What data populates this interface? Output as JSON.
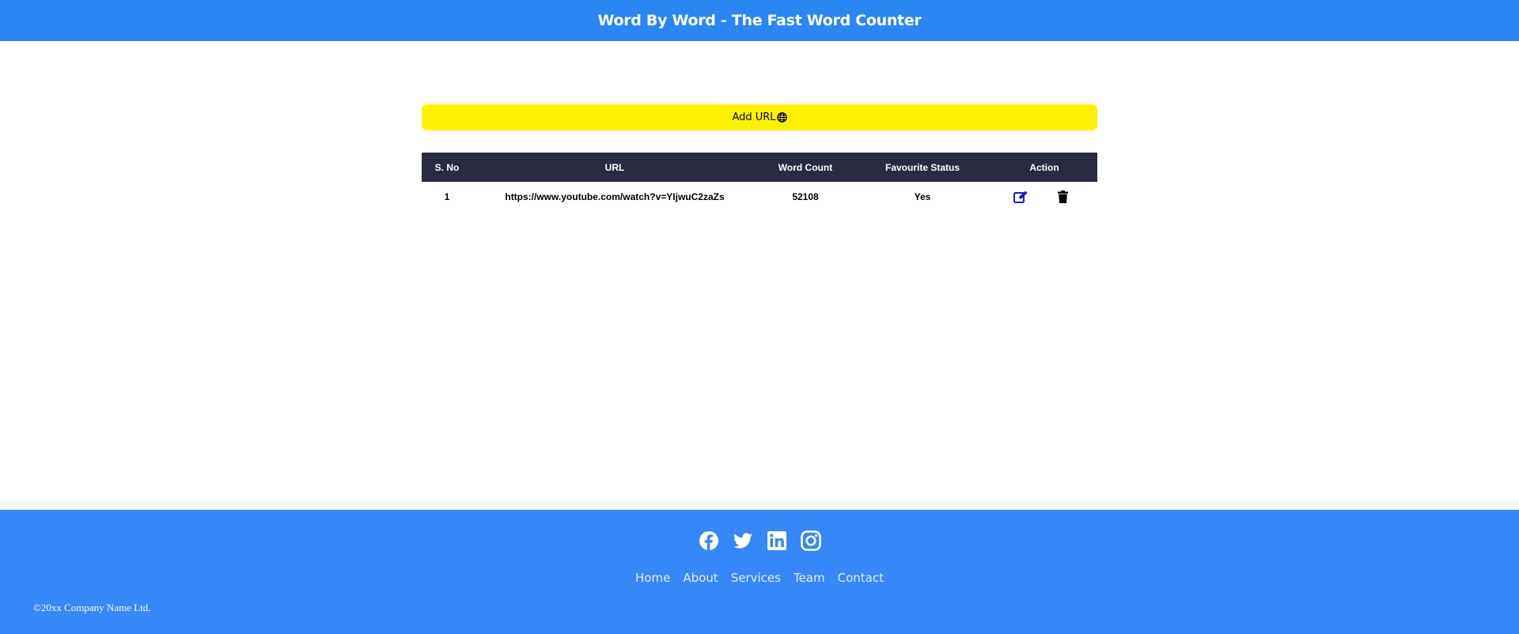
{
  "header": {
    "title": "Word By Word - The Fast Word Counter",
    "bg_color": "#2a86f2"
  },
  "add_url_button": {
    "label": "Add URL",
    "icon": "globe-icon",
    "bg_color": "#fff200"
  },
  "table": {
    "header_bg": "#292c41",
    "columns": [
      "S. No",
      "URL",
      "Word Count",
      "Favourite Status",
      "Action"
    ],
    "rows": [
      {
        "sno": "1",
        "url": "https://www.youtube.com/watch?v=YIjwuC2zaZs",
        "word_count": "52108",
        "favourite": "Yes",
        "actions": [
          "edit-icon",
          "trash-icon"
        ]
      }
    ]
  },
  "footer": {
    "bg_color": "#3687fa",
    "socials": [
      "facebook-icon",
      "twitter-icon",
      "linkedin-icon",
      "instagram-icon"
    ],
    "nav": [
      "Home",
      "About",
      "Services",
      "Team",
      "Contact"
    ],
    "copyright": "©20xx Company Name Ltd."
  }
}
